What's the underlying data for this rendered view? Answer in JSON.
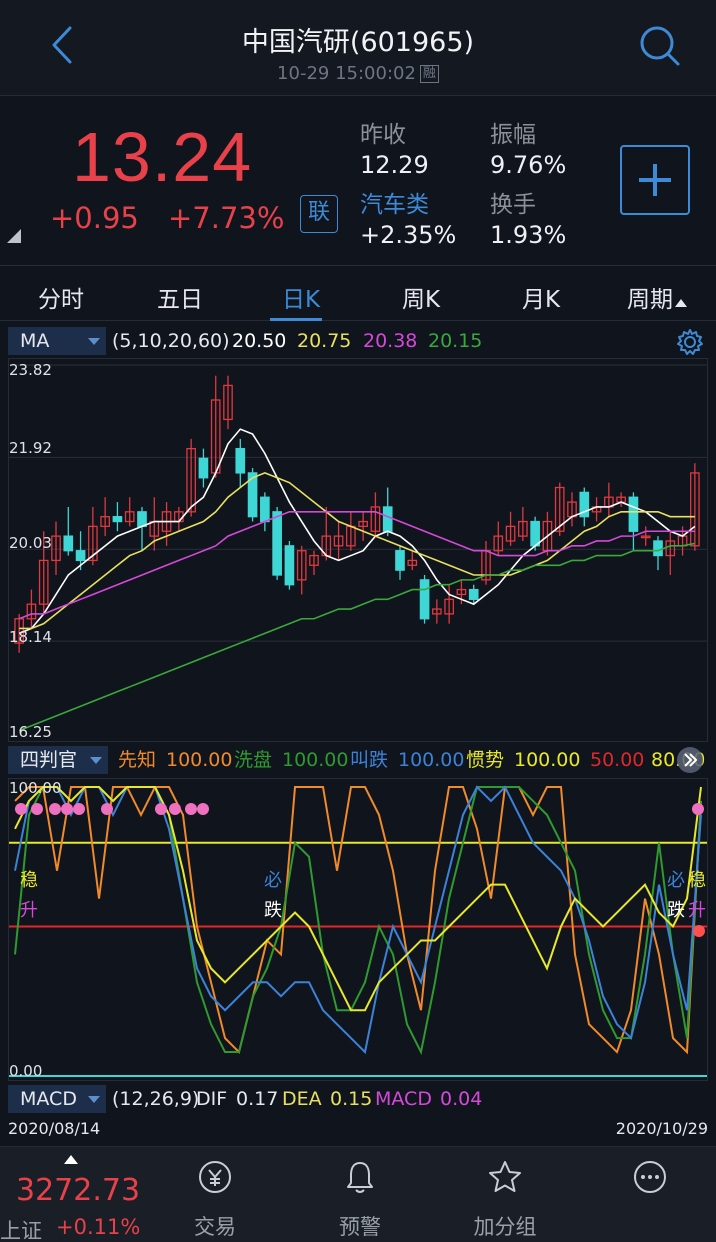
{
  "header": {
    "title": "中国汽研(601965)",
    "timestamp": "10-29 15:00:02",
    "badge": "融"
  },
  "quote": {
    "price": "13.24",
    "change": "+0.95",
    "change_pct": "+7.73%",
    "lian_label": "联",
    "prev_close_label": "昨收",
    "prev_close": "12.29",
    "amplitude_label": "振幅",
    "amplitude": "9.76%",
    "sector_label": "汽车类",
    "sector_change": "+2.35%",
    "turnover_label": "换手",
    "turnover": "1.93%",
    "colors": {
      "up": "#e8414a",
      "accent": "#3d8ad6"
    }
  },
  "tabs": [
    {
      "label": "分时"
    },
    {
      "label": "五日"
    },
    {
      "label": "日K"
    },
    {
      "label": "周K"
    },
    {
      "label": "月K"
    },
    {
      "label": "周期"
    }
  ],
  "ma_bar": {
    "selector": "MA",
    "params": "(5,10,20,60)",
    "ma5": "20.50",
    "ma10": "20.75",
    "ma20": "20.38",
    "ma60": "20.15"
  },
  "main_axis": [
    "23.82",
    "21.92",
    "20.03",
    "18.14",
    "16.25"
  ],
  "sub_bar": {
    "selector": "四判官",
    "xianzhi_label": "先知",
    "xianzhi": "100.00",
    "xipan_label": "洗盘",
    "xipan": "100.00",
    "jiaodie_label": "叫跌",
    "jiaodie": "100.00",
    "guanshi_label": "惯势",
    "guanshi": "100.00",
    "red_level": "50.00",
    "yellow_level": "80.00"
  },
  "sub_axis": {
    "top": "100.00",
    "bottom": "0.00"
  },
  "sub_markers": {
    "wen1": "稳",
    "sheng1": "升",
    "bi1": "必",
    "die1": "跌",
    "bi2": "必",
    "wen2": "稳",
    "die2": "跌",
    "sheng2": "升"
  },
  "macd_bar": {
    "selector": "MACD",
    "params": "(12,26,9)",
    "dif_label": "DIF",
    "dif": "0.17",
    "dea_label": "DEA",
    "dea": "0.15",
    "macd_label": "MACD",
    "macd": "0.04"
  },
  "dates": {
    "start": "2020/08/14",
    "end": "2020/10/29"
  },
  "bottom_nav": {
    "index_value": "3272.73",
    "index_name": "上证",
    "index_pct": "+0.11%",
    "trade": "交易",
    "alert": "预警",
    "watchlist": "加分组"
  },
  "chart_data": [
    {
      "type": "candlestick",
      "title": "日K",
      "ylim": [
        16.25,
        23.82
      ],
      "x_range": [
        "2020/08/14",
        "2020/10/29"
      ],
      "candles": [
        {
          "o": 18.1,
          "c": 18.6,
          "h": 18.7,
          "l": 17.9
        },
        {
          "o": 18.6,
          "c": 18.9,
          "h": 19.2,
          "l": 18.4
        },
        {
          "o": 18.9,
          "c": 19.8,
          "h": 20.4,
          "l": 18.7
        },
        {
          "o": 19.8,
          "c": 20.3,
          "h": 20.6,
          "l": 19.5
        },
        {
          "o": 20.3,
          "c": 20.0,
          "h": 20.9,
          "l": 19.9
        },
        {
          "o": 20.0,
          "c": 19.8,
          "h": 20.4,
          "l": 19.6
        },
        {
          "o": 19.8,
          "c": 20.5,
          "h": 20.9,
          "l": 19.7
        },
        {
          "o": 20.5,
          "c": 20.7,
          "h": 21.1,
          "l": 20.3
        },
        {
          "o": 20.7,
          "c": 20.6,
          "h": 21.0,
          "l": 20.4
        },
        {
          "o": 20.6,
          "c": 20.8,
          "h": 21.1,
          "l": 20.5
        },
        {
          "o": 20.8,
          "c": 20.5,
          "h": 20.9,
          "l": 20.0
        },
        {
          "o": 20.3,
          "c": 20.6,
          "h": 21.1,
          "l": 20.0
        },
        {
          "o": 20.4,
          "c": 20.8,
          "h": 21.0,
          "l": 20.1
        },
        {
          "o": 20.6,
          "c": 20.8,
          "h": 20.9,
          "l": 20.4
        },
        {
          "o": 20.8,
          "c": 22.1,
          "h": 22.3,
          "l": 20.7
        },
        {
          "o": 21.9,
          "c": 21.5,
          "h": 22.1,
          "l": 21.3
        },
        {
          "o": 21.6,
          "c": 23.1,
          "h": 23.6,
          "l": 21.5
        },
        {
          "o": 22.7,
          "c": 23.4,
          "h": 23.6,
          "l": 22.5
        },
        {
          "o": 22.1,
          "c": 21.6,
          "h": 22.3,
          "l": 21.3
        },
        {
          "o": 21.6,
          "c": 20.7,
          "h": 21.7,
          "l": 20.6
        },
        {
          "o": 21.1,
          "c": 20.6,
          "h": 21.2,
          "l": 20.4
        },
        {
          "o": 20.8,
          "c": 19.5,
          "h": 20.9,
          "l": 19.4
        },
        {
          "o": 20.1,
          "c": 19.3,
          "h": 20.2,
          "l": 19.2
        },
        {
          "o": 19.4,
          "c": 20.0,
          "h": 20.1,
          "l": 19.1
        },
        {
          "o": 19.7,
          "c": 19.9,
          "h": 20.0,
          "l": 19.5
        },
        {
          "o": 19.9,
          "c": 20.3,
          "h": 20.9,
          "l": 19.8
        },
        {
          "o": 20.1,
          "c": 20.3,
          "h": 20.6,
          "l": 19.8
        },
        {
          "o": 20.1,
          "c": 20.5,
          "h": 20.8,
          "l": 20.0
        },
        {
          "o": 20.5,
          "c": 20.6,
          "h": 20.8,
          "l": 20.2
        },
        {
          "o": 20.4,
          "c": 20.9,
          "h": 21.2,
          "l": 20.3
        },
        {
          "o": 20.9,
          "c": 20.4,
          "h": 21.3,
          "l": 20.3
        },
        {
          "o": 20.0,
          "c": 19.6,
          "h": 20.1,
          "l": 19.4
        },
        {
          "o": 19.7,
          "c": 19.8,
          "h": 20.0,
          "l": 19.6
        },
        {
          "o": 19.4,
          "c": 18.6,
          "h": 19.5,
          "l": 18.5
        },
        {
          "o": 18.7,
          "c": 18.8,
          "h": 19.0,
          "l": 18.5
        },
        {
          "o": 18.7,
          "c": 19.0,
          "h": 19.3,
          "l": 18.5
        },
        {
          "o": 19.1,
          "c": 19.2,
          "h": 19.4,
          "l": 18.9
        },
        {
          "o": 19.2,
          "c": 19.0,
          "h": 19.3,
          "l": 18.9
        },
        {
          "o": 19.4,
          "c": 20.0,
          "h": 20.2,
          "l": 19.3
        },
        {
          "o": 20.0,
          "c": 20.3,
          "h": 20.6,
          "l": 19.9
        },
        {
          "o": 20.2,
          "c": 20.5,
          "h": 20.8,
          "l": 20.1
        },
        {
          "o": 20.3,
          "c": 20.6,
          "h": 20.9,
          "l": 20.2
        },
        {
          "o": 20.6,
          "c": 20.1,
          "h": 20.7,
          "l": 20.0
        },
        {
          "o": 20.0,
          "c": 20.6,
          "h": 20.8,
          "l": 19.9
        },
        {
          "o": 20.4,
          "c": 21.3,
          "h": 21.4,
          "l": 20.3
        },
        {
          "o": 20.7,
          "c": 21.0,
          "h": 21.2,
          "l": 20.5
        },
        {
          "o": 21.2,
          "c": 20.7,
          "h": 21.3,
          "l": 20.5
        },
        {
          "o": 20.8,
          "c": 20.9,
          "h": 21.1,
          "l": 20.6
        },
        {
          "o": 20.9,
          "c": 21.1,
          "h": 21.4,
          "l": 20.7
        },
        {
          "o": 21.0,
          "c": 21.1,
          "h": 21.2,
          "l": 20.9
        },
        {
          "o": 21.1,
          "c": 20.4,
          "h": 21.2,
          "l": 20.0
        },
        {
          "o": 20.3,
          "c": 20.3,
          "h": 20.5,
          "l": 20.1
        },
        {
          "o": 20.2,
          "c": 19.9,
          "h": 20.3,
          "l": 19.6
        },
        {
          "o": 19.9,
          "c": 20.2,
          "h": 20.4,
          "l": 19.5
        },
        {
          "o": 20.1,
          "c": 20.3,
          "h": 20.5,
          "l": 19.9
        },
        {
          "o": 20.1,
          "c": 21.6,
          "h": 21.8,
          "l": 20.0
        }
      ],
      "series": [
        {
          "name": "MA5",
          "values": [
            18.3,
            18.4,
            18.7,
            19.1,
            19.5,
            19.7,
            19.9,
            20.1,
            20.3,
            20.4,
            20.5,
            20.6,
            20.6,
            20.6,
            20.9,
            21.1,
            21.6,
            22.2,
            22.5,
            22.4,
            22.0,
            21.5,
            21.0,
            20.6,
            20.2,
            19.9,
            19.8,
            19.9,
            20.0,
            20.3,
            20.4,
            20.3,
            20.1,
            19.8,
            19.4,
            19.1,
            19.0,
            18.9,
            19.1,
            19.3,
            19.6,
            19.9,
            20.1,
            20.3,
            20.5,
            20.7,
            20.8,
            20.9,
            20.9,
            21.0,
            20.9,
            20.8,
            20.6,
            20.4,
            20.3,
            20.5
          ]
        },
        {
          "name": "MA10",
          "values": [
            18.4,
            18.4,
            18.5,
            18.7,
            18.9,
            19.1,
            19.3,
            19.5,
            19.7,
            19.9,
            20.0,
            20.2,
            20.3,
            20.4,
            20.5,
            20.6,
            20.8,
            21.1,
            21.3,
            21.5,
            21.6,
            21.5,
            21.4,
            21.2,
            21.0,
            20.8,
            20.6,
            20.5,
            20.4,
            20.3,
            20.2,
            20.1,
            20.0,
            19.9,
            19.8,
            19.7,
            19.6,
            19.5,
            19.5,
            19.5,
            19.5,
            19.6,
            19.7,
            19.8,
            20.0,
            20.2,
            20.4,
            20.5,
            20.7,
            20.8,
            20.8,
            20.8,
            20.8,
            20.7,
            20.7,
            20.7
          ]
        },
        {
          "name": "MA20",
          "values": [
            18.6,
            18.7,
            18.7,
            18.8,
            18.9,
            19.0,
            19.1,
            19.2,
            19.3,
            19.4,
            19.5,
            19.6,
            19.7,
            19.8,
            19.9,
            20.0,
            20.1,
            20.3,
            20.4,
            20.5,
            20.6,
            20.7,
            20.8,
            20.8,
            20.8,
            20.8,
            20.8,
            20.8,
            20.8,
            20.8,
            20.7,
            20.6,
            20.5,
            20.4,
            20.3,
            20.2,
            20.1,
            20.0,
            20.0,
            19.9,
            19.9,
            19.9,
            19.9,
            20.0,
            20.0,
            20.1,
            20.1,
            20.2,
            20.2,
            20.3,
            20.3,
            20.4,
            20.4,
            20.4,
            20.4,
            20.4
          ]
        },
        {
          "name": "MA60",
          "values": [
            16.3,
            16.4,
            16.5,
            16.6,
            16.7,
            16.8,
            16.9,
            17.0,
            17.1,
            17.2,
            17.3,
            17.4,
            17.5,
            17.6,
            17.7,
            17.8,
            17.9,
            18.0,
            18.1,
            18.2,
            18.3,
            18.4,
            18.5,
            18.6,
            18.6,
            18.7,
            18.8,
            18.8,
            18.9,
            19.0,
            19.0,
            19.1,
            19.2,
            19.2,
            19.3,
            19.3,
            19.4,
            19.4,
            19.5,
            19.5,
            19.6,
            19.6,
            19.7,
            19.7,
            19.7,
            19.8,
            19.8,
            19.9,
            19.9,
            19.9,
            20.0,
            20.0,
            20.0,
            20.1,
            20.1,
            20.15
          ]
        }
      ]
    },
    {
      "type": "line",
      "title": "四判官",
      "ylim": [
        0,
        100
      ],
      "reference_lines": [
        {
          "value": 80,
          "color": "#e8e82a"
        },
        {
          "value": 50,
          "color": "#e0282a"
        }
      ],
      "series": [
        {
          "name": "先知",
          "color": "#f08a2a",
          "values": [
            95,
            100,
            100,
            70,
            100,
            100,
            60,
            100,
            100,
            90,
            100,
            100,
            90,
            50,
            30,
            10,
            5,
            25,
            45,
            40,
            100,
            100,
            100,
            70,
            100,
            100,
            90,
            70,
            40,
            20,
            70,
            100,
            100,
            85,
            60,
            100,
            100,
            90,
            100,
            100,
            40,
            15,
            10,
            5,
            20,
            60,
            40,
            10,
            5,
            95
          ]
        },
        {
          "name": "洗盘",
          "color": "#2f9a2f",
          "values": [
            40,
            90,
            100,
            100,
            95,
            100,
            100,
            95,
            100,
            100,
            100,
            90,
            60,
            30,
            15,
            5,
            5,
            25,
            35,
            50,
            80,
            75,
            40,
            20,
            20,
            30,
            50,
            40,
            15,
            5,
            30,
            60,
            80,
            100,
            100,
            100,
            100,
            95,
            90,
            80,
            70,
            40,
            20,
            10,
            10,
            40,
            80,
            40,
            10,
            95
          ]
        },
        {
          "name": "叫跌",
          "color": "#3b82d8",
          "values": [
            70,
            95,
            100,
            100,
            90,
            100,
            100,
            90,
            100,
            100,
            100,
            85,
            60,
            35,
            25,
            20,
            25,
            30,
            30,
            25,
            30,
            30,
            20,
            15,
            10,
            5,
            30,
            50,
            40,
            30,
            50,
            70,
            90,
            100,
            95,
            100,
            90,
            80,
            75,
            70,
            60,
            45,
            25,
            15,
            10,
            30,
            65,
            40,
            20,
            90
          ]
        },
        {
          "name": "惯势",
          "color": "#e8e82a",
          "values": [
            85,
            95,
            100,
            100,
            95,
            100,
            100,
            95,
            100,
            100,
            100,
            90,
            70,
            45,
            35,
            30,
            35,
            40,
            45,
            50,
            55,
            50,
            40,
            30,
            20,
            20,
            30,
            35,
            40,
            45,
            45,
            50,
            55,
            60,
            65,
            65,
            55,
            45,
            35,
            50,
            60,
            55,
            50,
            55,
            60,
            65,
            55,
            50,
            60,
            100
          ]
        }
      ]
    },
    {
      "type": "line",
      "title": "MACD",
      "series": [
        {
          "name": "DIF",
          "values": [
            0.17
          ]
        },
        {
          "name": "DEA",
          "values": [
            0.15
          ]
        },
        {
          "name": "MACD",
          "values": [
            0.04
          ]
        }
      ]
    }
  ]
}
